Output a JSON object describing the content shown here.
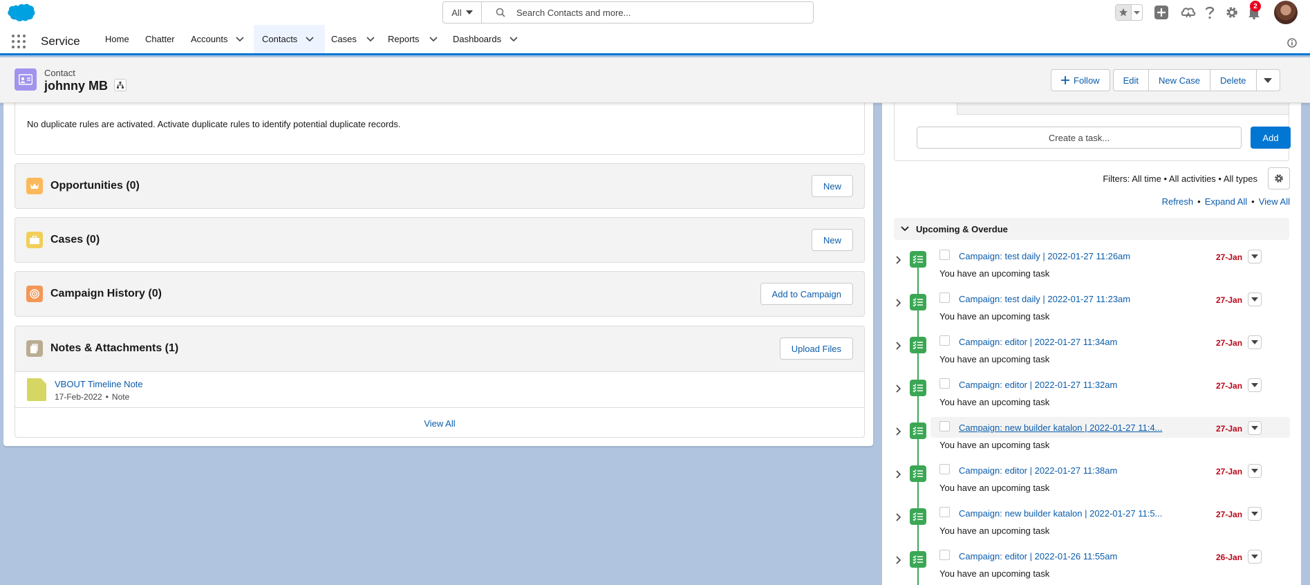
{
  "search": {
    "scope": "All",
    "placeholder": "Search Contacts and more..."
  },
  "header": {
    "notification_count": "2"
  },
  "nav": {
    "app_name": "Service",
    "items": [
      {
        "label": "Home"
      },
      {
        "label": "Chatter"
      },
      {
        "label": "Accounts"
      },
      {
        "label": "Contacts"
      },
      {
        "label": "Cases"
      },
      {
        "label": "Reports"
      },
      {
        "label": "Dashboards"
      }
    ]
  },
  "record": {
    "type": "Contact",
    "name": "johnny MB",
    "actions": {
      "follow": "Follow",
      "edit": "Edit",
      "new_case": "New Case",
      "delete": "Delete"
    }
  },
  "duplicates": {
    "message": "No duplicate rules are activated. Activate duplicate rules to identify potential duplicate records."
  },
  "related_lists": [
    {
      "title": "Opportunities (0)",
      "button": "New",
      "icon": "crown-icon",
      "color": "#fcb95b"
    },
    {
      "title": "Cases (0)",
      "button": "New",
      "icon": "briefcase-icon",
      "color": "#f2cf5b"
    },
    {
      "title": "Campaign History (0)",
      "button": "Add to Campaign",
      "icon": "target-icon",
      "color": "#f49756"
    }
  ],
  "notes": {
    "title": "Notes & Attachments (1)",
    "button": "Upload Files",
    "item": {
      "title": "VBOUT Timeline Note",
      "date": "17-Feb-2022",
      "separator": "•",
      "kind": "Note"
    },
    "view_all": "View All"
  },
  "activity": {
    "task_placeholder": "Create a task...",
    "add_label": "Add",
    "filters": "Filters: All time • All activities • All types",
    "links": {
      "refresh": "Refresh",
      "sep": "•",
      "expand_all": "Expand All",
      "view_all": "View All"
    },
    "section_title": "Upcoming & Overdue",
    "tasks": [
      {
        "title": "Campaign: test daily | 2022-01-27 11:26am",
        "sub": "You have an upcoming task",
        "date": "27-Jan"
      },
      {
        "title": "Campaign: test daily | 2022-01-27 11:23am",
        "sub": "You have an upcoming task",
        "date": "27-Jan"
      },
      {
        "title": "Campaign: editor | 2022-01-27 11:34am",
        "sub": "You have an upcoming task",
        "date": "27-Jan"
      },
      {
        "title": "Campaign: editor | 2022-01-27 11:32am",
        "sub": "You have an upcoming task",
        "date": "27-Jan"
      },
      {
        "title": "Campaign: new builder katalon | 2022-01-27 11:4...",
        "sub": "You have an upcoming task",
        "date": "27-Jan"
      },
      {
        "title": "Campaign: editor | 2022-01-27 11:38am",
        "sub": "You have an upcoming task",
        "date": "27-Jan"
      },
      {
        "title": "Campaign: new builder katalon | 2022-01-27 11:5...",
        "sub": "You have an upcoming task",
        "date": "27-Jan"
      },
      {
        "title": "Campaign: editor | 2022-01-26 11:55am",
        "sub": "You have an upcoming task",
        "date": "26-Jan"
      }
    ]
  },
  "colors": {
    "brand": "#0176d3",
    "task_green": "#3ba755",
    "overdue_red": "#ba0517",
    "contact_purple": "#a094ed"
  }
}
